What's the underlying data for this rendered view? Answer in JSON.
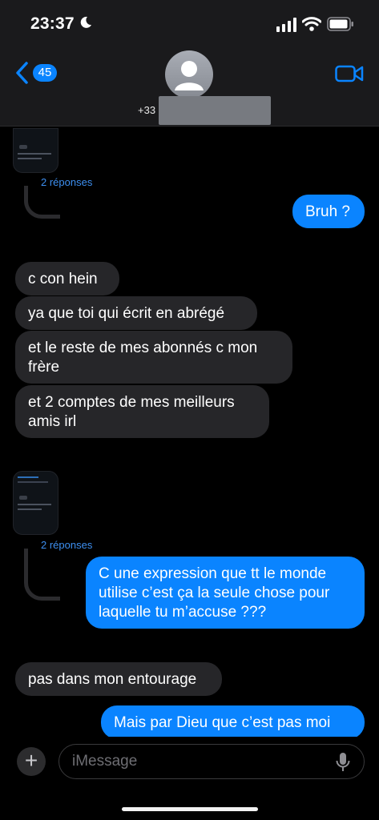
{
  "status_bar": {
    "time": "23:37"
  },
  "header": {
    "back_count": "45",
    "contact_number": "+33"
  },
  "threads": [
    {
      "replies_label": "2 réponses"
    },
    {
      "replies_label": "2 réponses"
    }
  ],
  "messages": [
    {
      "sender": "me",
      "text": "Bruh ?"
    },
    {
      "sender": "them",
      "text": "c con hein"
    },
    {
      "sender": "them",
      "text": "ya que toi qui écrit en abrégé"
    },
    {
      "sender": "them",
      "text": "et le reste de mes abonnés c mon\nfrère"
    },
    {
      "sender": "them",
      "text": "et 2 comptes de mes meilleurs\namis irl"
    },
    {
      "sender": "me",
      "text": "C une expression que tt le monde\nutilise c’est ça la seule chose pour\nlaquelle tu m’accuse ???"
    },
    {
      "sender": "them",
      "text": "pas dans mon entourage"
    },
    {
      "sender": "me",
      "text": "Mais par Dieu que c’est pas moi"
    }
  ],
  "composer": {
    "placeholder": "iMessage"
  },
  "colors": {
    "accent": "#0a84ff",
    "incoming": "#262629",
    "header": "#1a1a1c"
  }
}
